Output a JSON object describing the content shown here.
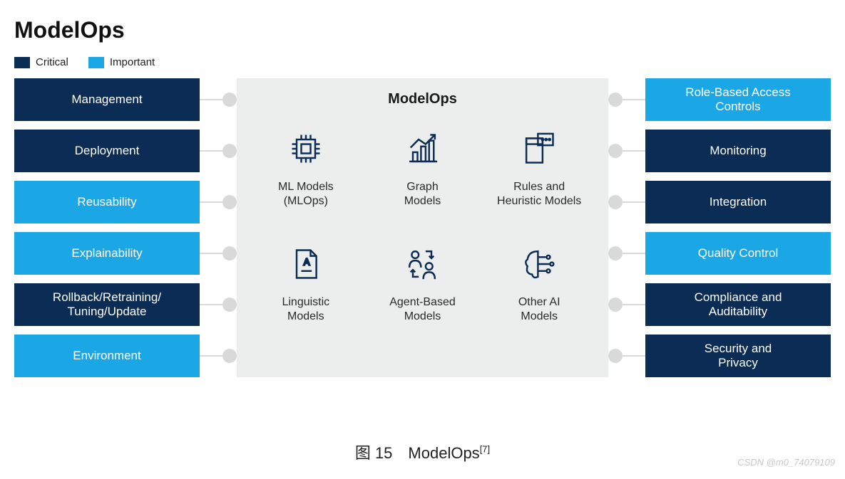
{
  "title": "ModelOps",
  "legend": {
    "critical": "Critical",
    "important": "Important"
  },
  "colors": {
    "critical": "#0a2c55",
    "important": "#1ba7e6",
    "panel_bg": "#eceded",
    "connector": "#d9d9d9"
  },
  "left": [
    {
      "label": "Management",
      "class": "critical"
    },
    {
      "label": "Deployment",
      "class": "critical"
    },
    {
      "label": "Reusability",
      "class": "important"
    },
    {
      "label": "Explainability",
      "class": "important"
    },
    {
      "label": "Rollback/Retraining/\nTuning/Update",
      "class": "critical"
    },
    {
      "label": "Environment",
      "class": "important"
    }
  ],
  "right": [
    {
      "label": "Role-Based Access\nControls",
      "class": "important"
    },
    {
      "label": "Monitoring",
      "class": "critical"
    },
    {
      "label": "Integration",
      "class": "critical"
    },
    {
      "label": "Quality Control",
      "class": "important"
    },
    {
      "label": "Compliance and\nAuditability",
      "class": "critical"
    },
    {
      "label": "Security and\nPrivacy",
      "class": "critical"
    }
  ],
  "center": {
    "title": "ModelOps",
    "items": [
      {
        "icon": "chip-icon",
        "label": "ML Models\n(MLOps)"
      },
      {
        "icon": "graph-icon",
        "label": "Graph\nModels"
      },
      {
        "icon": "rules-icon",
        "label": "Rules and\nHeuristic Models"
      },
      {
        "icon": "doc-icon",
        "label": "Linguistic\nModels"
      },
      {
        "icon": "agents-icon",
        "label": "Agent-Based\nModels"
      },
      {
        "icon": "brain-icon",
        "label": "Other AI\nModels"
      }
    ]
  },
  "caption": {
    "prefix": "图 15　ModelOps",
    "sup": "[7]"
  },
  "watermark": "CSDN @m0_74079109"
}
